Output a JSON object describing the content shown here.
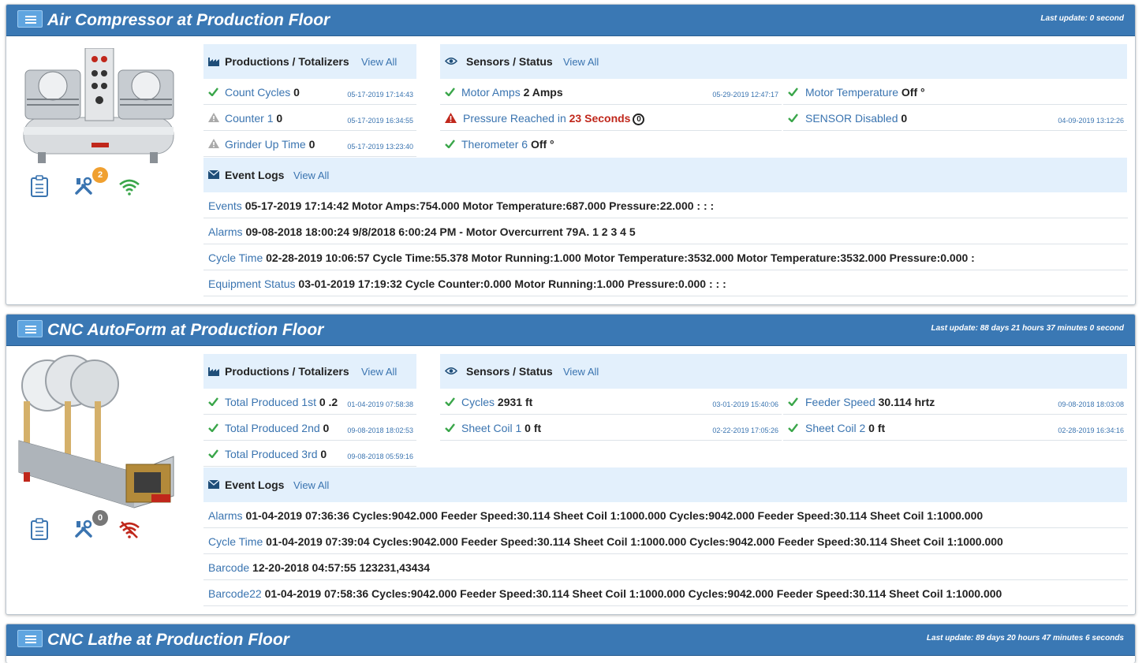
{
  "colors": {
    "header": "#3a78b4",
    "link": "#3a74b0",
    "ok": "#3aa64a",
    "warn": "#aaaaaa",
    "alarm": "#c0271b",
    "badge_orange": "#f0a030",
    "badge_gray": "#777777"
  },
  "panels": [
    {
      "title": "Air Compressor at Production Floor",
      "last_update": "Last update: 0 second",
      "maintenance_badge": "2",
      "connectivity": "wifi-connected",
      "productions": {
        "title": "Productions / Totalizers",
        "view_all": "View All",
        "items": [
          {
            "status": "ok",
            "label": "Count Cycles",
            "value": "0",
            "ts": "05-17-2019 17:14:43"
          },
          {
            "status": "warn",
            "label": "Counter 1",
            "value": "0",
            "ts": "05-17-2019 16:34:55"
          },
          {
            "status": "warn",
            "label": "Grinder Up Time",
            "value": "0",
            "ts": "05-17-2019 13:23:40"
          }
        ]
      },
      "sensors": {
        "title": "Sensors / Status",
        "view_all": "View All",
        "motor_amps": {
          "label": "Motor Amps",
          "value": "2 Amps",
          "ts": "05-29-2019 12:47:17"
        },
        "motor_temp": {
          "label": "Motor Temperature",
          "value": "Off",
          "unit": "°"
        },
        "pressure": {
          "label": "Pressure Reached in",
          "value": "23 Seconds",
          "mark": "0"
        },
        "sensor_disabled": {
          "label": "SENSOR Disabled",
          "value": "0",
          "ts": "04-09-2019 13:12:26"
        },
        "therometer": {
          "label": "Therometer 6",
          "value": "Off",
          "unit": "°"
        }
      },
      "event_logs": {
        "title": "Event Logs",
        "view_all": "View All",
        "items": [
          {
            "label": "Events",
            "value": "05-17-2019 17:14:42 Motor Amps:754.000 Motor Temperature:687.000 Pressure:22.000 : : :"
          },
          {
            "label": "Alarms",
            "value": "09-08-2018 18:00:24 9/8/2018 6:00:24 PM - Motor Overcurrent 79A. 1 2 3 4 5"
          },
          {
            "label": "Cycle Time",
            "value": "02-28-2019 10:06:57 Cycle Time:55.378 Motor Running:1.000 Motor Temperature:3532.000 Motor Temperature:3532.000 Pressure:0.000 :"
          },
          {
            "label": "Equipment Status",
            "value": "03-01-2019 17:19:32 Cycle Counter:0.000 Motor Running:1.000 Pressure:0.000 : : :"
          }
        ]
      }
    },
    {
      "title": "CNC AutoForm at Production Floor",
      "last_update": "Last update: 88 days 21 hours 37 minutes 0 second",
      "maintenance_badge": "0",
      "connectivity": "wifi-disconnected",
      "productions": {
        "title": "Productions / Totalizers",
        "view_all": "View All",
        "items": [
          {
            "status": "ok",
            "label": "Total Produced 1st",
            "value": "0 .2",
            "ts": "01-04-2019 07:58:38"
          },
          {
            "status": "ok",
            "label": "Total Produced 2nd",
            "value": "0",
            "ts": "09-08-2018 18:02:53"
          },
          {
            "status": "ok",
            "label": "Total Produced 3rd",
            "value": "0",
            "ts": "09-08-2018 05:59:16"
          }
        ]
      },
      "sensors": {
        "title": "Sensors / Status",
        "view_all": "View All",
        "items": [
          {
            "status": "ok",
            "label": "Cycles",
            "value": "2931 ft",
            "ts": "03-01-2019 15:40:06"
          },
          {
            "status": "ok",
            "label": "Feeder Speed",
            "value": "30.114 hrtz",
            "ts": "09-08-2018 18:03:08"
          },
          {
            "status": "ok",
            "label": "Sheet Coil 1",
            "value": "0 ft",
            "ts": "02-22-2019 17:05:26"
          },
          {
            "status": "ok",
            "label": "Sheet Coil 2",
            "value": "0 ft",
            "ts": "02-28-2019 16:34:16"
          }
        ]
      },
      "event_logs": {
        "title": "Event Logs",
        "view_all": "View All",
        "items": [
          {
            "label": "Alarms",
            "value": "01-04-2019 07:36:36 Cycles:9042.000 Feeder Speed:30.114 Sheet Coil 1:1000.000 Cycles:9042.000 Feeder Speed:30.114 Sheet Coil 1:1000.000"
          },
          {
            "label": "Cycle Time",
            "value": "01-04-2019 07:39:04 Cycles:9042.000 Feeder Speed:30.114 Sheet Coil 1:1000.000 Cycles:9042.000 Feeder Speed:30.114 Sheet Coil 1:1000.000"
          },
          {
            "label": "Barcode",
            "value": "12-20-2018 04:57:55 123231,43434"
          },
          {
            "label": "Barcode22",
            "value": "01-04-2019 07:58:36 Cycles:9042.000 Feeder Speed:30.114 Sheet Coil 1:1000.000 Cycles:9042.000 Feeder Speed:30.114 Sheet Coil 1:1000.000"
          }
        ]
      }
    },
    {
      "title": "CNC Lathe at Production Floor",
      "last_update": "Last update: 89 days 20 hours 47 minutes 6 seconds"
    }
  ]
}
